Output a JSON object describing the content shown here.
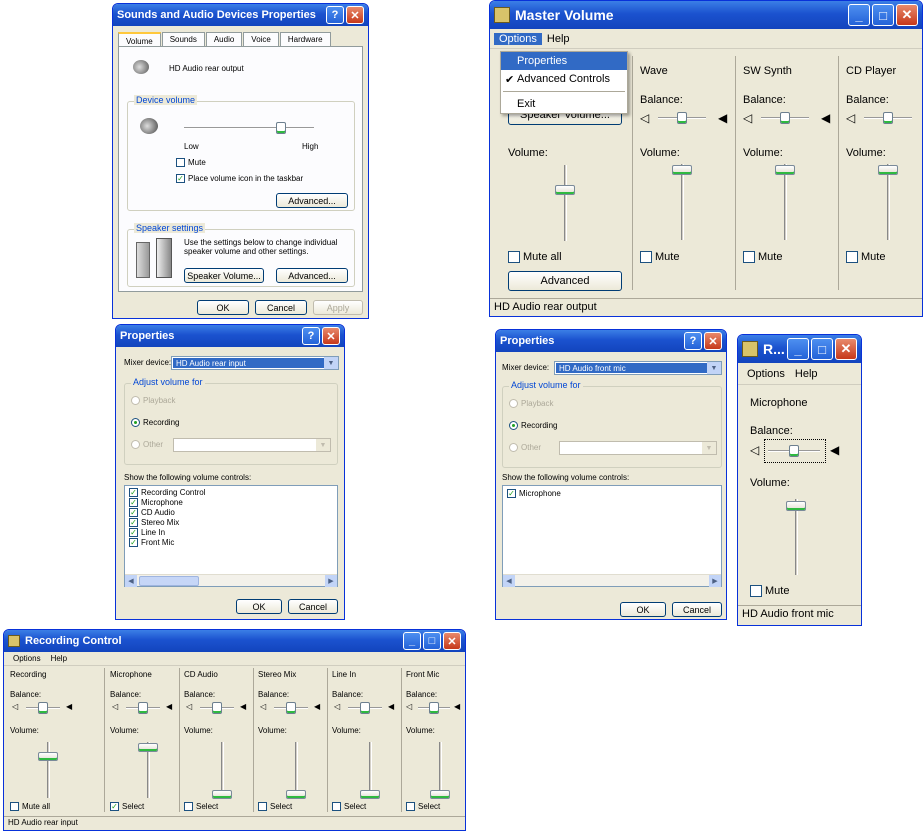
{
  "sounds": {
    "title": "Sounds and Audio Devices Properties",
    "tabs": [
      "Volume",
      "Sounds",
      "Audio",
      "Voice",
      "Hardware"
    ],
    "device_name": "HD Audio rear output",
    "device_volume_label": "Device volume",
    "low": "Low",
    "high": "High",
    "mute": "Mute",
    "mute_checked": false,
    "place_icon": "Place volume icon in the taskbar",
    "place_icon_checked": true,
    "advanced": "Advanced...",
    "speaker_settings_label": "Speaker settings",
    "speaker_text": "Use the settings below to change individual speaker volume and other settings.",
    "speaker_volume": "Speaker Volume...",
    "advanced2": "Advanced...",
    "ok": "OK",
    "cancel": "Cancel",
    "apply": "Apply"
  },
  "master": {
    "title": "Master Volume",
    "menu": [
      "Options",
      "Help"
    ],
    "dropdown": [
      "Properties",
      "Advanced Controls",
      "Exit"
    ],
    "check_mark": "✔",
    "partial_button": "Speaker Volume...",
    "volume_label": "Volume:",
    "balance_label": "Balance:",
    "channels": [
      "Wave",
      "SW Synth",
      "CD Player"
    ],
    "mute_all": "Mute all",
    "mute": "Mute",
    "advanced": "Advanced",
    "status": "HD Audio rear output"
  },
  "props1": {
    "title": "Properties",
    "mixer_label": "Mixer device:",
    "mixer_value": "HD Audio rear input",
    "adjust_label": "Adjust volume for",
    "playback": "Playback",
    "recording": "Recording",
    "other": "Other",
    "show_label": "Show the following volume controls:",
    "controls": [
      "Recording Control",
      "Microphone",
      "CD Audio",
      "Stereo Mix",
      "Line In",
      "Front Mic"
    ],
    "ok": "OK",
    "cancel": "Cancel"
  },
  "props2": {
    "title": "Properties",
    "mixer_label": "Mixer device:",
    "mixer_value": "HD Audio front mic",
    "adjust_label": "Adjust volume for",
    "playback": "Playback",
    "recording": "Recording",
    "other": "Other",
    "show_label": "Show the following volume controls:",
    "controls": [
      "Microphone"
    ],
    "ok": "OK",
    "cancel": "Cancel"
  },
  "smallrec": {
    "title": "R...",
    "menu": [
      "Options",
      "Help"
    ],
    "channel": "Microphone",
    "balance_label": "Balance:",
    "volume_label": "Volume:",
    "mute": "Mute",
    "status": "HD Audio front mic"
  },
  "rec": {
    "title": "Recording Control",
    "menu": [
      "Options",
      "Help"
    ],
    "balance_label": "Balance:",
    "volume_label": "Volume:",
    "channels": [
      "Recording",
      "Microphone",
      "CD Audio",
      "Stereo Mix",
      "Line In",
      "Front Mic"
    ],
    "mute_all": "Mute all",
    "select": "Select",
    "select_checked": [
      false,
      true,
      false,
      false,
      false,
      false
    ],
    "status": "HD Audio rear input"
  },
  "glyphs": {
    "close": "✕",
    "help": "?",
    "min": "_",
    "max": "□",
    "down": "▼",
    "left": "◀",
    "right": "▶",
    "check": "✓",
    "spk_left": "🔈",
    "spk_right": "🔉"
  }
}
